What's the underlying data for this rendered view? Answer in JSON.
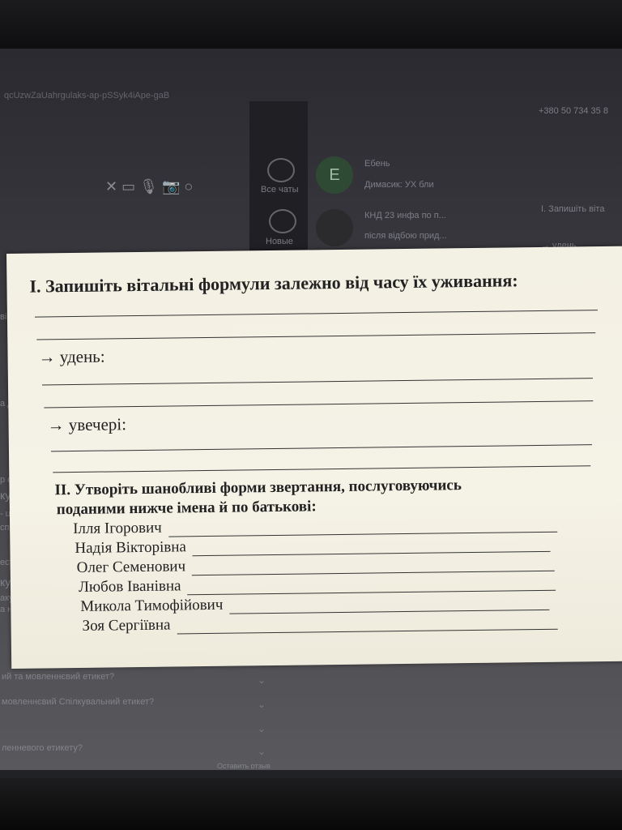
{
  "background": {
    "phone": "+380 50 734 35 8",
    "chat_tab": "Все чаты",
    "chat_tab_2": "Новые",
    "chat1_name": "Ебень",
    "chat1_preview": "Димасик: УХ бли",
    "chat2_name": "КНД 23 инфа по п...",
    "chat2_preview": "після відбою прид...",
    "right_heading": "І. Запишіть віта",
    "right_sub": "→ удень",
    "footer_q1": "ий та мовленнєвий етикет?",
    "footer_q2": "мовленнєвий Спілкувальний етикет?",
    "footer_q3": "ленневого етикету?",
    "feedback": "Оставить отзыв",
    "left_fragments": [
      "кува",
      "- це сис",
      "спільно",
      "ести эту",
      "кувальн",
      "аку мовц",
      "а націонал",
      "а дл",
      "р страт",
      "ві"
    ]
  },
  "worksheet": {
    "task1_title": "І. Запишіть вітальні формули залежно від часу їх уживання:",
    "day_label": "→ удень:",
    "evening_label": "→ увечері:",
    "task2_title_line1": "ІІ. Утворіть шанобливі форми звертання, послуговуючись",
    "task2_title_line2": "поданими нижче імена й по батькові:",
    "names": [
      "Ілля Ігорович",
      "Надія  Вікторівна",
      "Олег Семенович",
      "Любов Іванівна",
      "Микола Тимофійович",
      "Зоя Сергіївна"
    ]
  }
}
